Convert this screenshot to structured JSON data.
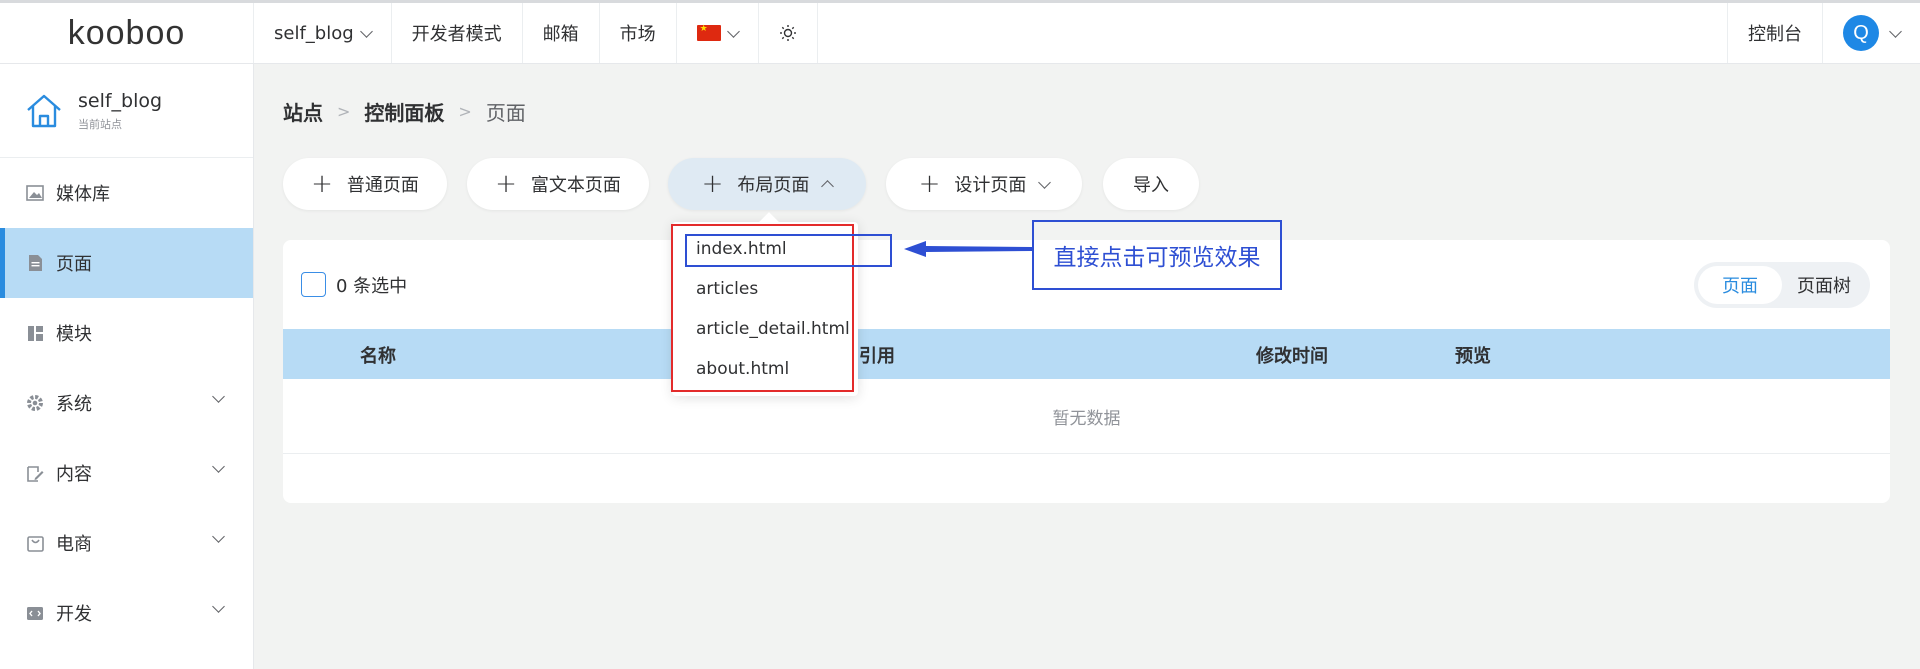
{
  "topbar": {
    "logo": "kooboo",
    "site_selector": "self_blog",
    "nav": [
      "开发者模式",
      "邮箱",
      "市场"
    ],
    "console": "控制台",
    "avatar_letter": "Q"
  },
  "sidebar": {
    "site_name": "self_blog",
    "site_sub": "当前站点",
    "items": [
      {
        "label": "媒体库",
        "icon": "image-icon"
      },
      {
        "label": "页面",
        "icon": "page-icon"
      },
      {
        "label": "模块",
        "icon": "module-icon"
      },
      {
        "label": "系统",
        "icon": "gear-icon"
      },
      {
        "label": "内容",
        "icon": "edit-icon"
      },
      {
        "label": "电商",
        "icon": "shop-icon"
      },
      {
        "label": "开发",
        "icon": "code-icon"
      }
    ]
  },
  "breadcrumb": [
    "站点",
    "控制面板",
    "页面"
  ],
  "toolbar": {
    "normal_page": "普通页面",
    "rich_text_page": "富文本页面",
    "layout_page": "布局页面",
    "design_page": "设计页面",
    "import": "导入"
  },
  "panel": {
    "selected": "0 条选中",
    "view_page": "页面",
    "view_tree": "页面树",
    "columns": {
      "name": "名称",
      "reference": "引用",
      "modified": "修改时间",
      "preview": "预览"
    },
    "empty": "暂无数据"
  },
  "dropdown": {
    "items": [
      "index.html",
      "articles",
      "article_detail.html",
      "about.html"
    ]
  },
  "annotation": "直接点击可预览效果",
  "colors": {
    "accent": "#2a8cdf",
    "active_bg": "#b7dbf5",
    "highlight_red": "#e32b2b",
    "highlight_blue": "#2e4fd3"
  }
}
